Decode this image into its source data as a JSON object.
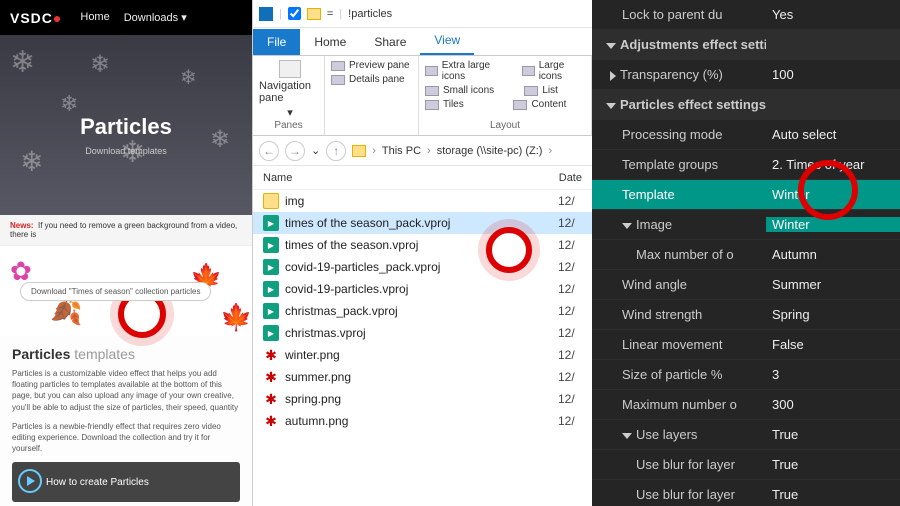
{
  "site": {
    "logo": "VSDC",
    "nav": {
      "home": "Home",
      "downloads": "Downloads ▾"
    },
    "hero_title": "Particles",
    "hero_sub": "Download templates",
    "news_label": "News:",
    "news_text": "If you need to remove a green background from a video, there is",
    "download_btn": "Download \"Times of season\" collection particles",
    "templates_heading_a": "Particles",
    "templates_heading_b": "templates",
    "para1": "Particles is a customizable video effect that helps you add floating particles to templates available at the bottom of this page, but you can also upload any image of your own creative, you'll be able to adjust the size of particles, their speed, quantity",
    "para2": "Particles is a newbie-friendly effect that requires zero video editing experience. Download the collection and try it for yourself.",
    "video_title": "How to create Particles"
  },
  "explorer": {
    "window_title": "!particles",
    "tabs": {
      "file": "File",
      "home": "Home",
      "share": "Share",
      "view": "View"
    },
    "ribbon": {
      "nav_pane": "Navigation pane",
      "preview": "Preview pane",
      "details": "Details pane",
      "panes": "Panes",
      "xl": "Extra large icons",
      "large": "Large icons",
      "small": "Small icons",
      "list": "List",
      "tiles": "Tiles",
      "content": "Content",
      "layout": "Layout"
    },
    "crumbs": {
      "pc": "This PC",
      "drive": "storage (\\\\site-pc) (Z:)"
    },
    "columns": {
      "name": "Name",
      "date": "Date"
    },
    "files": [
      {
        "name": "img",
        "type": "folder",
        "date": "12/"
      },
      {
        "name": "times of the season_pack.vproj",
        "type": "vproj",
        "date": "12/",
        "selected": true
      },
      {
        "name": "times of the season.vproj",
        "type": "vproj",
        "date": "12/"
      },
      {
        "name": "covid-19-particles_pack.vproj",
        "type": "vproj",
        "date": "12/"
      },
      {
        "name": "covid-19-particles.vproj",
        "type": "vproj",
        "date": "12/"
      },
      {
        "name": "christmas_pack.vproj",
        "type": "vproj",
        "date": "12/"
      },
      {
        "name": "christmas.vproj",
        "type": "vproj",
        "date": "12/"
      },
      {
        "name": "winter.png",
        "type": "png",
        "date": "12/"
      },
      {
        "name": "summer.png",
        "type": "png",
        "date": "12/"
      },
      {
        "name": "spring.png",
        "type": "png",
        "date": "12/"
      },
      {
        "name": "autumn.png",
        "type": "png",
        "date": "12/"
      }
    ]
  },
  "props": {
    "lock_parent": {
      "label": "Lock to parent du",
      "value": "Yes"
    },
    "hdr_adjust": "Adjustments effect settings",
    "transparency": {
      "label": "Transparency (%)",
      "value": "100"
    },
    "hdr_particles": "Particles effect settings",
    "processing": {
      "label": "Processing mode",
      "value": "Auto select"
    },
    "tgroups": {
      "label": "Template groups",
      "value": "2. Times of year"
    },
    "template": {
      "label": "Template",
      "value": "Winter"
    },
    "image": {
      "label": "Image",
      "value": ""
    },
    "dropdown": [
      "Winter",
      "Autumn",
      "Summer",
      "Spring"
    ],
    "maxobj": {
      "label": "Max number of o",
      "value": ""
    },
    "wind_angle": {
      "label": "Wind angle",
      "value": ""
    },
    "wind_strength": {
      "label": "Wind strength",
      "value": ""
    },
    "linear": {
      "label": "Linear movement",
      "value": "False"
    },
    "size": {
      "label": "Size of particle %",
      "value": "3"
    },
    "maxnum": {
      "label": "Maximum number o",
      "value": "300"
    },
    "use_layers": {
      "label": "Use layers",
      "value": "True"
    },
    "blur1": {
      "label": "Use blur for layer",
      "value": "True"
    },
    "blur2": {
      "label": "Use blur for layer",
      "value": "True"
    }
  }
}
